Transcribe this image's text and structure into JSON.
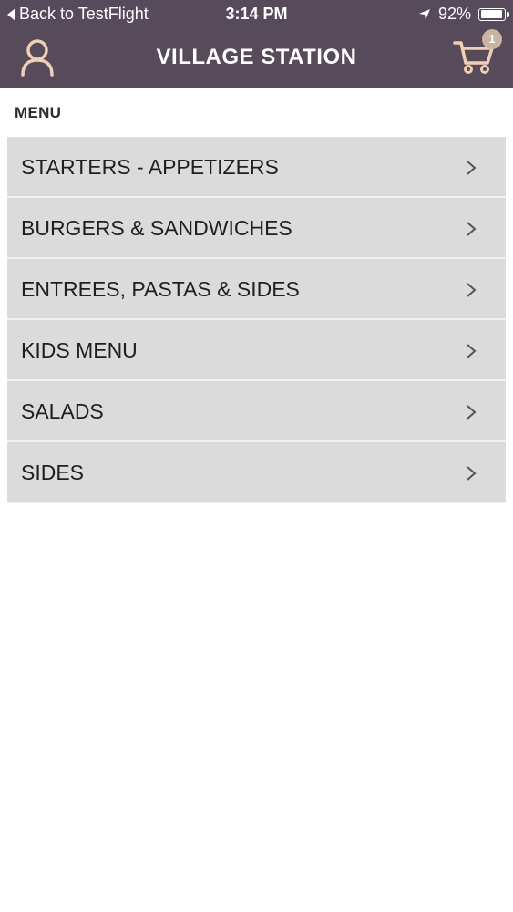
{
  "status_bar": {
    "back_label": "Back to TestFlight",
    "time": "3:14 PM",
    "battery": "92%",
    "battery_level": 0.92
  },
  "header": {
    "title": "VILLAGE STATION",
    "cart_count": "1"
  },
  "section_title": "MENU",
  "menu_items": [
    {
      "label": "STARTERS - APPETIZERS"
    },
    {
      "label": "BURGERS & SANDWICHES"
    },
    {
      "label": "ENTREES, PASTAS & SIDES"
    },
    {
      "label": "KIDS MENU"
    },
    {
      "label": "SALADS"
    },
    {
      "label": "SIDES"
    }
  ],
  "colors": {
    "header_bg": "#574a5a",
    "icon_accent": "#f1cfb6",
    "row_bg": "#dcdbdc"
  }
}
